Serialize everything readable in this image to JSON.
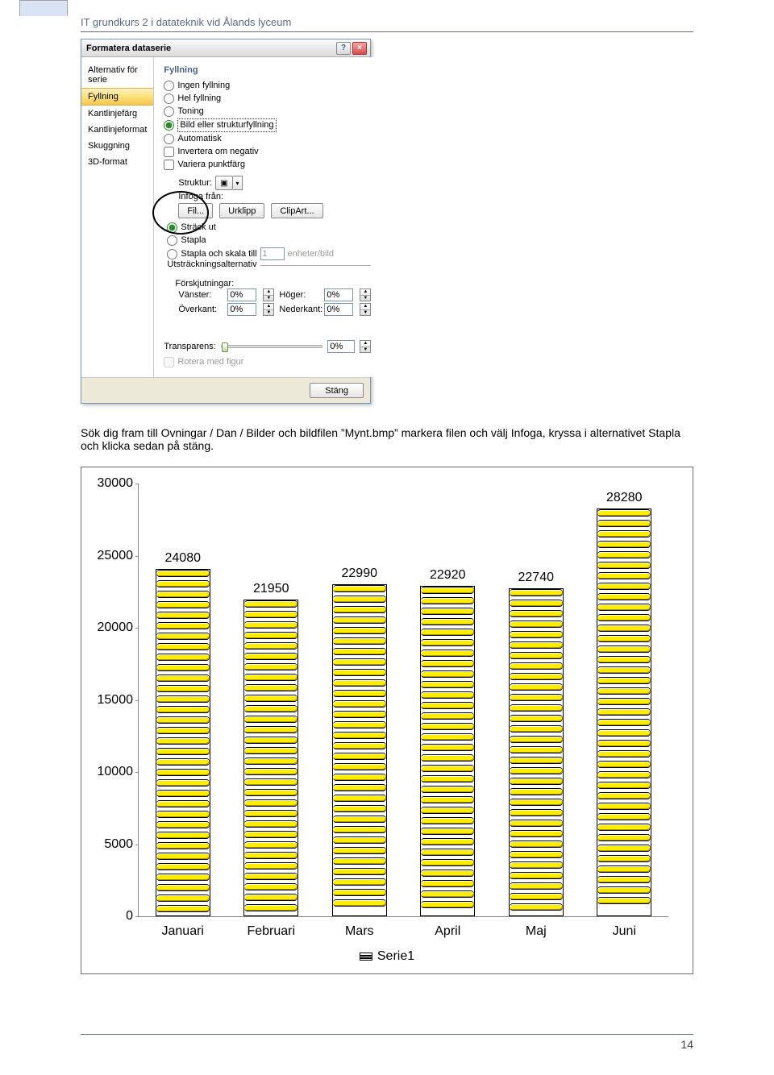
{
  "header": {
    "title": "IT grundkurs 2 i datateknik vid Ålands lyceum"
  },
  "dialog": {
    "title": "Formatera dataserie",
    "help_aria": "Hjälp",
    "close_aria": "Stäng",
    "nav": [
      {
        "label": "Alternativ för serie",
        "selected": false
      },
      {
        "label": "Fyllning",
        "selected": true
      },
      {
        "label": "Kantlinjefärg",
        "selected": false
      },
      {
        "label": "Kantlinjeformat",
        "selected": false
      },
      {
        "label": "Skuggning",
        "selected": false
      },
      {
        "label": "3D-format",
        "selected": false
      }
    ],
    "heading": "Fyllning",
    "radios": {
      "none": "Ingen fyllning",
      "solid": "Hel fyllning",
      "gradient": "Toning",
      "picture": "Bild eller strukturfyllning",
      "automatic": "Automatisk"
    },
    "checks": {
      "invert": "Invertera om negativ",
      "vary": "Variera punktfärg"
    },
    "struktur_label": "Struktur:",
    "infoga_label": "Infoga från:",
    "insert_buttons": {
      "file": "Fil...",
      "clipboard": "Urklipp",
      "clipart": "ClipArt..."
    },
    "tile_options": {
      "stretch": "Sträck ut",
      "stack": "Stapla",
      "stack_scale": "Stapla och skala till",
      "stack_scale_value": "1",
      "units_label": "enheter/bild"
    },
    "stretch_heading": "Utsträckningsalternativ",
    "offsets_label": "Förskjutningar:",
    "offsets": {
      "left_label": "Vänster:",
      "left_val": "0%",
      "right_label": "Höger:",
      "right_val": "0%",
      "top_label": "Överkant:",
      "top_val": "0%",
      "bottom_label": "Nederkant:",
      "bottom_val": "0%"
    },
    "transparency_label": "Transparens:",
    "transparency_val": "0%",
    "rotate_label": "Rotera med figur",
    "close_button": "Stäng"
  },
  "body_text": "Sök dig fram till Ovningar / Dan / Bilder och bildfilen ”Mynt.bmp” markera filen och välj Infoga, kryssa i alternativet Stapla och klicka sedan på stäng.",
  "chart_data": {
    "type": "bar",
    "categories": [
      "Januari",
      "Februari",
      "Mars",
      "April",
      "Maj",
      "Juni"
    ],
    "series": [
      {
        "name": "Serie1",
        "values": [
          24080,
          21950,
          22990,
          22920,
          22740,
          28280
        ]
      }
    ],
    "ylim": [
      0,
      30000
    ],
    "yticks": [
      0,
      5000,
      10000,
      15000,
      20000,
      25000,
      30000
    ],
    "data_labels": [
      24080,
      21950,
      22990,
      22920,
      22740,
      28280
    ]
  },
  "page_number": "14"
}
